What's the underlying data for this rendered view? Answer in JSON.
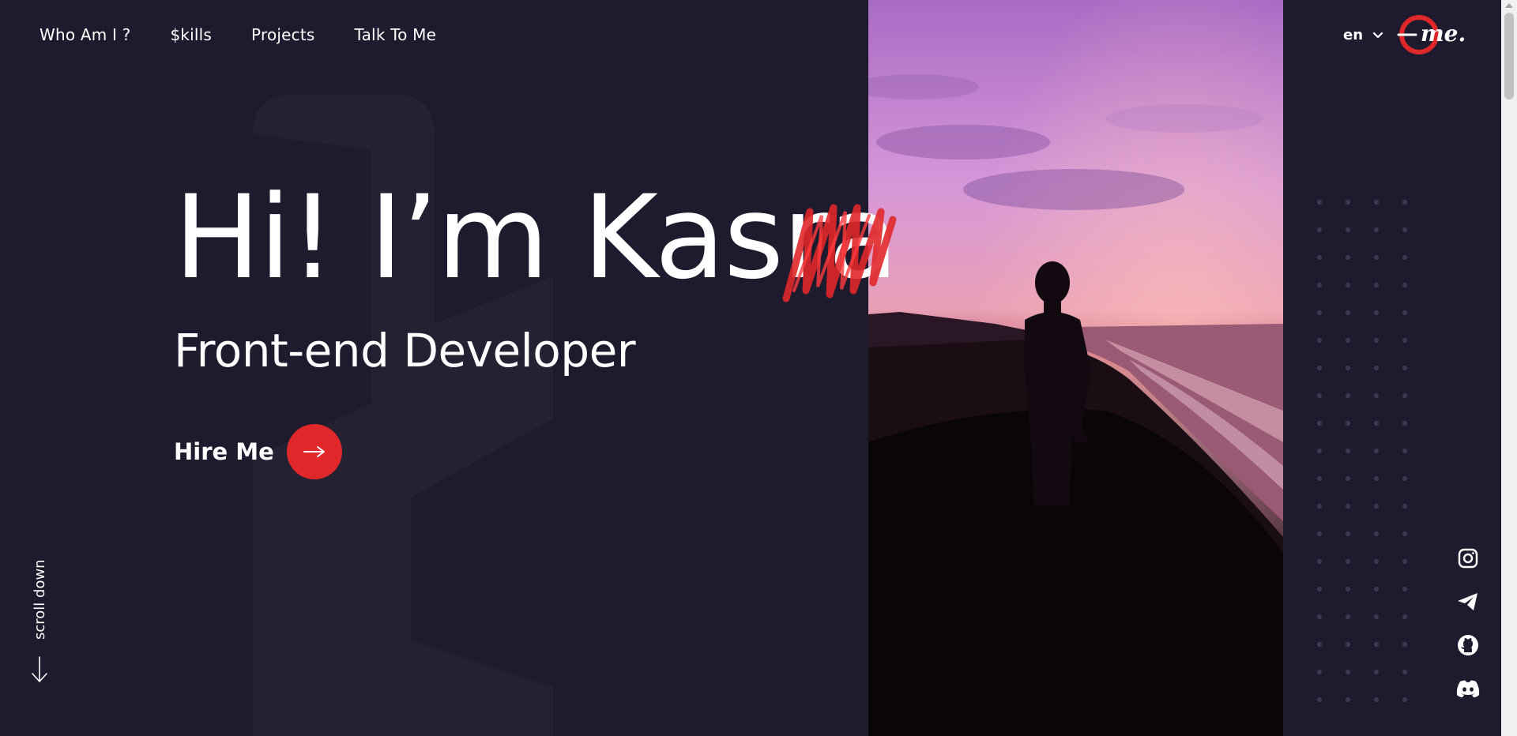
{
  "nav": {
    "items": [
      {
        "label": "Who Am I ?"
      },
      {
        "label": "$kills"
      },
      {
        "label": "Projects"
      },
      {
        "label": "Talk To Me"
      }
    ]
  },
  "hero": {
    "title": "Hi! I’m Kasra",
    "subtitle": "Front-end Developer",
    "cta_label": "Hire Me"
  },
  "scroll": {
    "label": "scroll down"
  },
  "language": {
    "selected": "en"
  },
  "logo": {
    "text": "me."
  },
  "social": [
    "instagram-icon",
    "telegram-icon",
    "github-icon",
    "discord-icon"
  ],
  "colors": {
    "background": "#1e1b2e",
    "accent": "#e0282a",
    "text": "#ffffff",
    "dots": "#3a3750"
  }
}
